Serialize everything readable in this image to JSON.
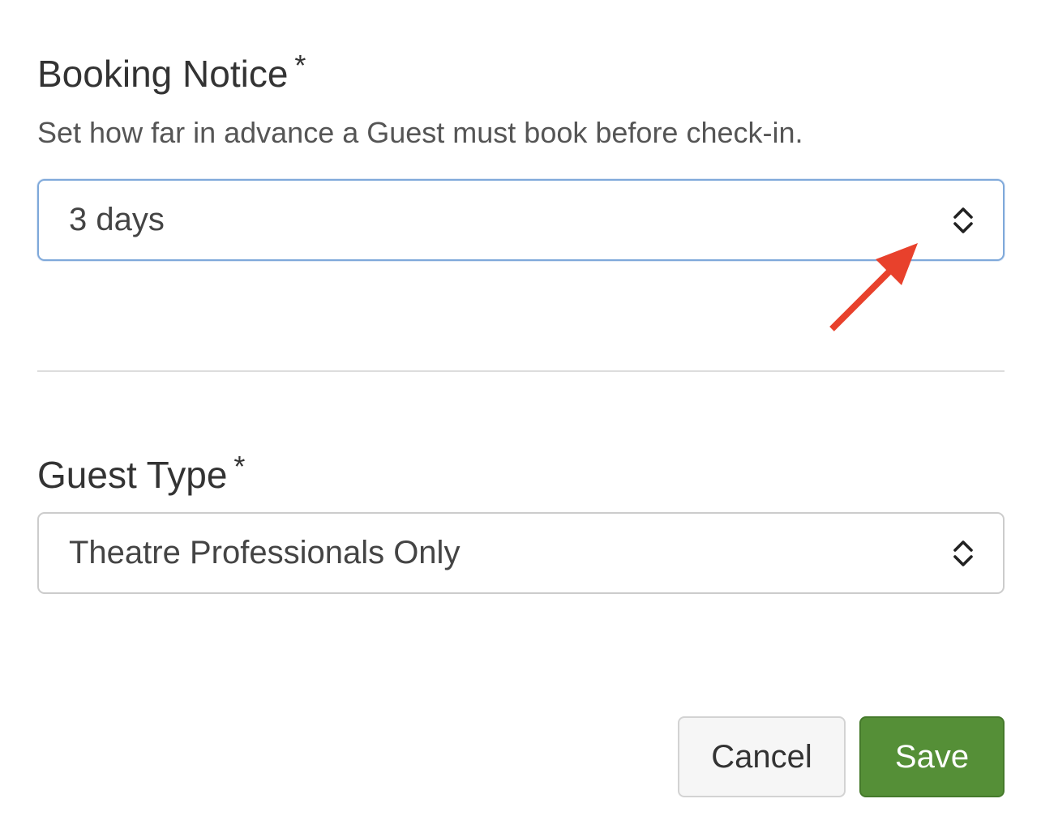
{
  "booking_notice": {
    "label": "Booking Notice",
    "required_mark": "*",
    "help_text": "Set how far in advance a Guest must book before check-in.",
    "selected_value": "3 days"
  },
  "guest_type": {
    "label": "Guest Type",
    "required_mark": "*",
    "selected_value": "Theatre Professionals Only"
  },
  "actions": {
    "cancel_label": "Cancel",
    "save_label": "Save"
  },
  "colors": {
    "focus_border": "#7fa9da",
    "save_button": "#558f37",
    "annotation_arrow": "#e8412c"
  },
  "icons": {
    "select_toggle": "chevron-up-down-icon",
    "annotation": "red-arrow-icon"
  }
}
